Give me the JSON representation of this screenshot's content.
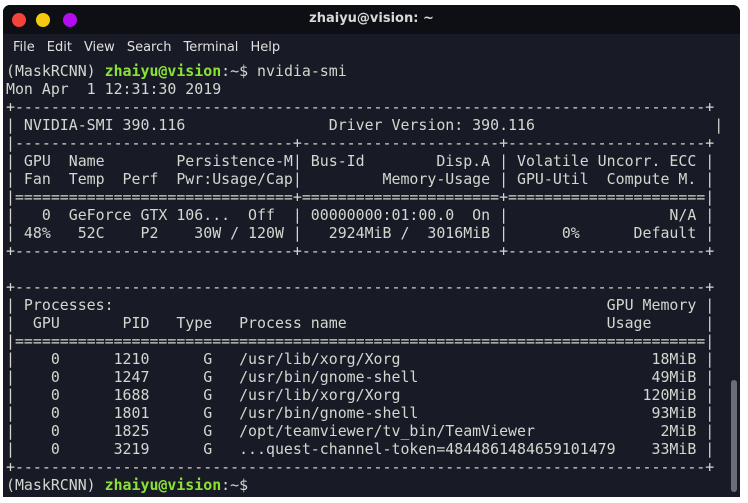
{
  "window": {
    "title": "zhaiyu@vision: ~",
    "buttons": {
      "close_color": "#f4433b",
      "minimize_color": "#f6c90e",
      "maximize_color": "#b40cf0"
    }
  },
  "menu": [
    "File",
    "Edit",
    "View",
    "Search",
    "Terminal",
    "Help"
  ],
  "colors": {
    "background": "#181b26",
    "text": "#d3d7cf",
    "prompt_user": "#8ae234"
  },
  "prompt": {
    "env": "(MaskRCNN) ",
    "user_host": "zhaiyu@vision",
    "suffix": ":~$ ",
    "command": "nvidia-smi"
  },
  "output": [
    "Mon Apr  1 12:31:30 2019",
    "+-----------------------------------------------------------------------------+",
    "| NVIDIA-SMI 390.116                Driver Version: 390.116                    |",
    "|-------------------------------+----------------------+----------------------+",
    "| GPU  Name        Persistence-M| Bus-Id        Disp.A | Volatile Uncorr. ECC |",
    "| Fan  Temp  Perf  Pwr:Usage/Cap|         Memory-Usage | GPU-Util  Compute M. |",
    "|===============================+======================+======================|",
    "|   0  GeForce GTX 106...  Off  | 00000000:01:00.0  On |                  N/A |",
    "| 48%   52C    P2    30W / 120W |   2924MiB /  3016MiB |      0%      Default |",
    "+-------------------------------+----------------------+----------------------+",
    "",
    "+-----------------------------------------------------------------------------+",
    "| Processes:                                                       GPU Memory |",
    "|  GPU       PID   Type   Process name                             Usage      |",
    "|=============================================================================|",
    "|    0      1210      G   /usr/lib/xorg/Xorg                            18MiB |",
    "|    0      1247      G   /usr/bin/gnome-shell                          49MiB |",
    "|    0      1688      G   /usr/lib/xorg/Xorg                           120MiB |",
    "|    0      1801      G   /usr/bin/gnome-shell                          93MiB |",
    "|    0      1825      G   /opt/teamviewer/tv_bin/TeamViewer              2MiB |",
    "|    0      3219      G   ...quest-channel-token=4844861484659101479    33MiB |",
    "+-----------------------------------------------------------------------------+"
  ]
}
